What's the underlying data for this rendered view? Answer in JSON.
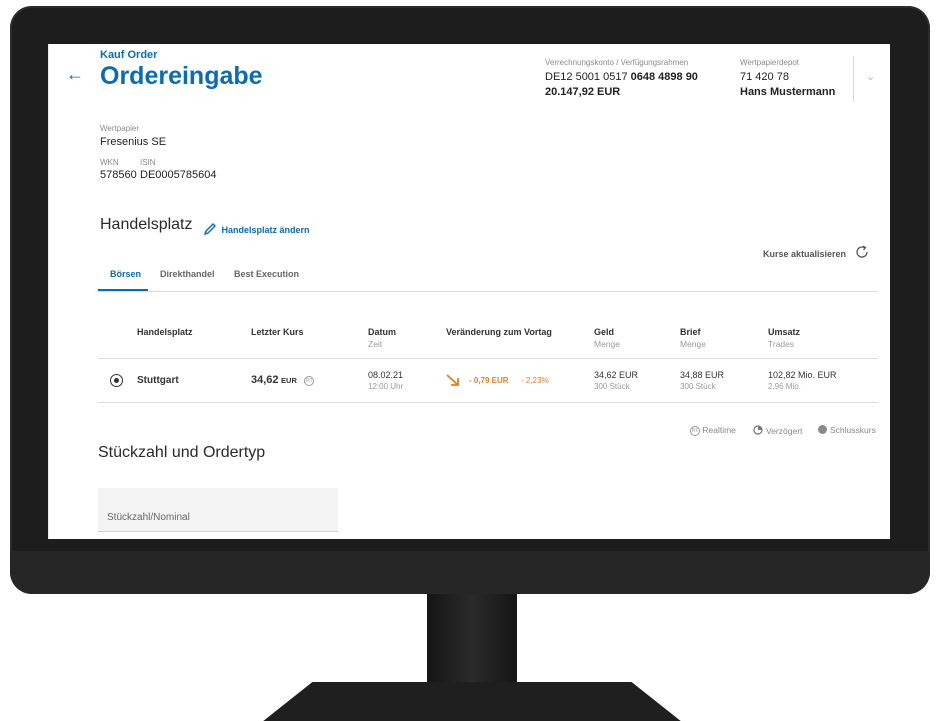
{
  "header": {
    "subtitle": "Kauf Order",
    "title": "Ordereingabe",
    "back_icon": "arrow-left-icon",
    "account_label": "Verrechnungskonto / Verfügungsrahmen",
    "iban_prefix": "DE12 5001 0517 ",
    "iban_bold": "0648 4898 90",
    "balance": "20.147,92 EUR",
    "depot_label": "Wertpapierdepot",
    "depot_number": "71 420 78",
    "depot_owner": "Hans Mustermann"
  },
  "security": {
    "label": "Wertpapier",
    "name": "Fresenius SE",
    "wkn_label": "WKN",
    "wkn": "578560",
    "isin_label": "ISIN",
    "isin": "DE0005785604"
  },
  "venue": {
    "section_title": "Handelsplatz",
    "change_link": "Handelsplatz ändern",
    "refresh_label": "Kurse aktualisieren",
    "tabs": [
      {
        "label": "Börsen",
        "active": true
      },
      {
        "label": "Direkthandel",
        "active": false
      },
      {
        "label": "Best Execution",
        "active": false
      }
    ],
    "columns": {
      "handelsplatz": "Handelsplatz",
      "kurs": "Letzter Kurs",
      "datum": "Datum",
      "datum_sub": "Zeit",
      "veraenderung": "Veränderung zum Vortag",
      "geld": "Geld",
      "geld_sub": "Menge",
      "brief": "Brief",
      "brief_sub": "Menge",
      "umsatz": "Umsatz",
      "umsatz_sub": "Trades"
    },
    "row": {
      "name": "Stuttgart",
      "kurs": "34,62",
      "kurs_currency": "EUR",
      "badge": "RT",
      "datum": "08.02.21",
      "zeit": "12:00 Uhr",
      "change_abs": "- 0,79 EUR",
      "change_pct": "- 2,23%",
      "geld": "34,62 EUR",
      "geld_menge": "300 Stück",
      "brief": "34,88 EUR",
      "brief_menge": "300 Stück",
      "umsatz": "102,82 Mio. EUR",
      "trades": "2,96 Mio."
    },
    "legend": {
      "realtime": "Realtime",
      "verzoegert": "Verzögert",
      "schlusskurs": "Schlusskurs"
    }
  },
  "order": {
    "section_title": "Stückzahl und Ordertyp",
    "qty_placeholder": "Stückzahl/Nominal"
  },
  "colors": {
    "accent": "#0a6bb8",
    "negative": "#e57e25"
  }
}
